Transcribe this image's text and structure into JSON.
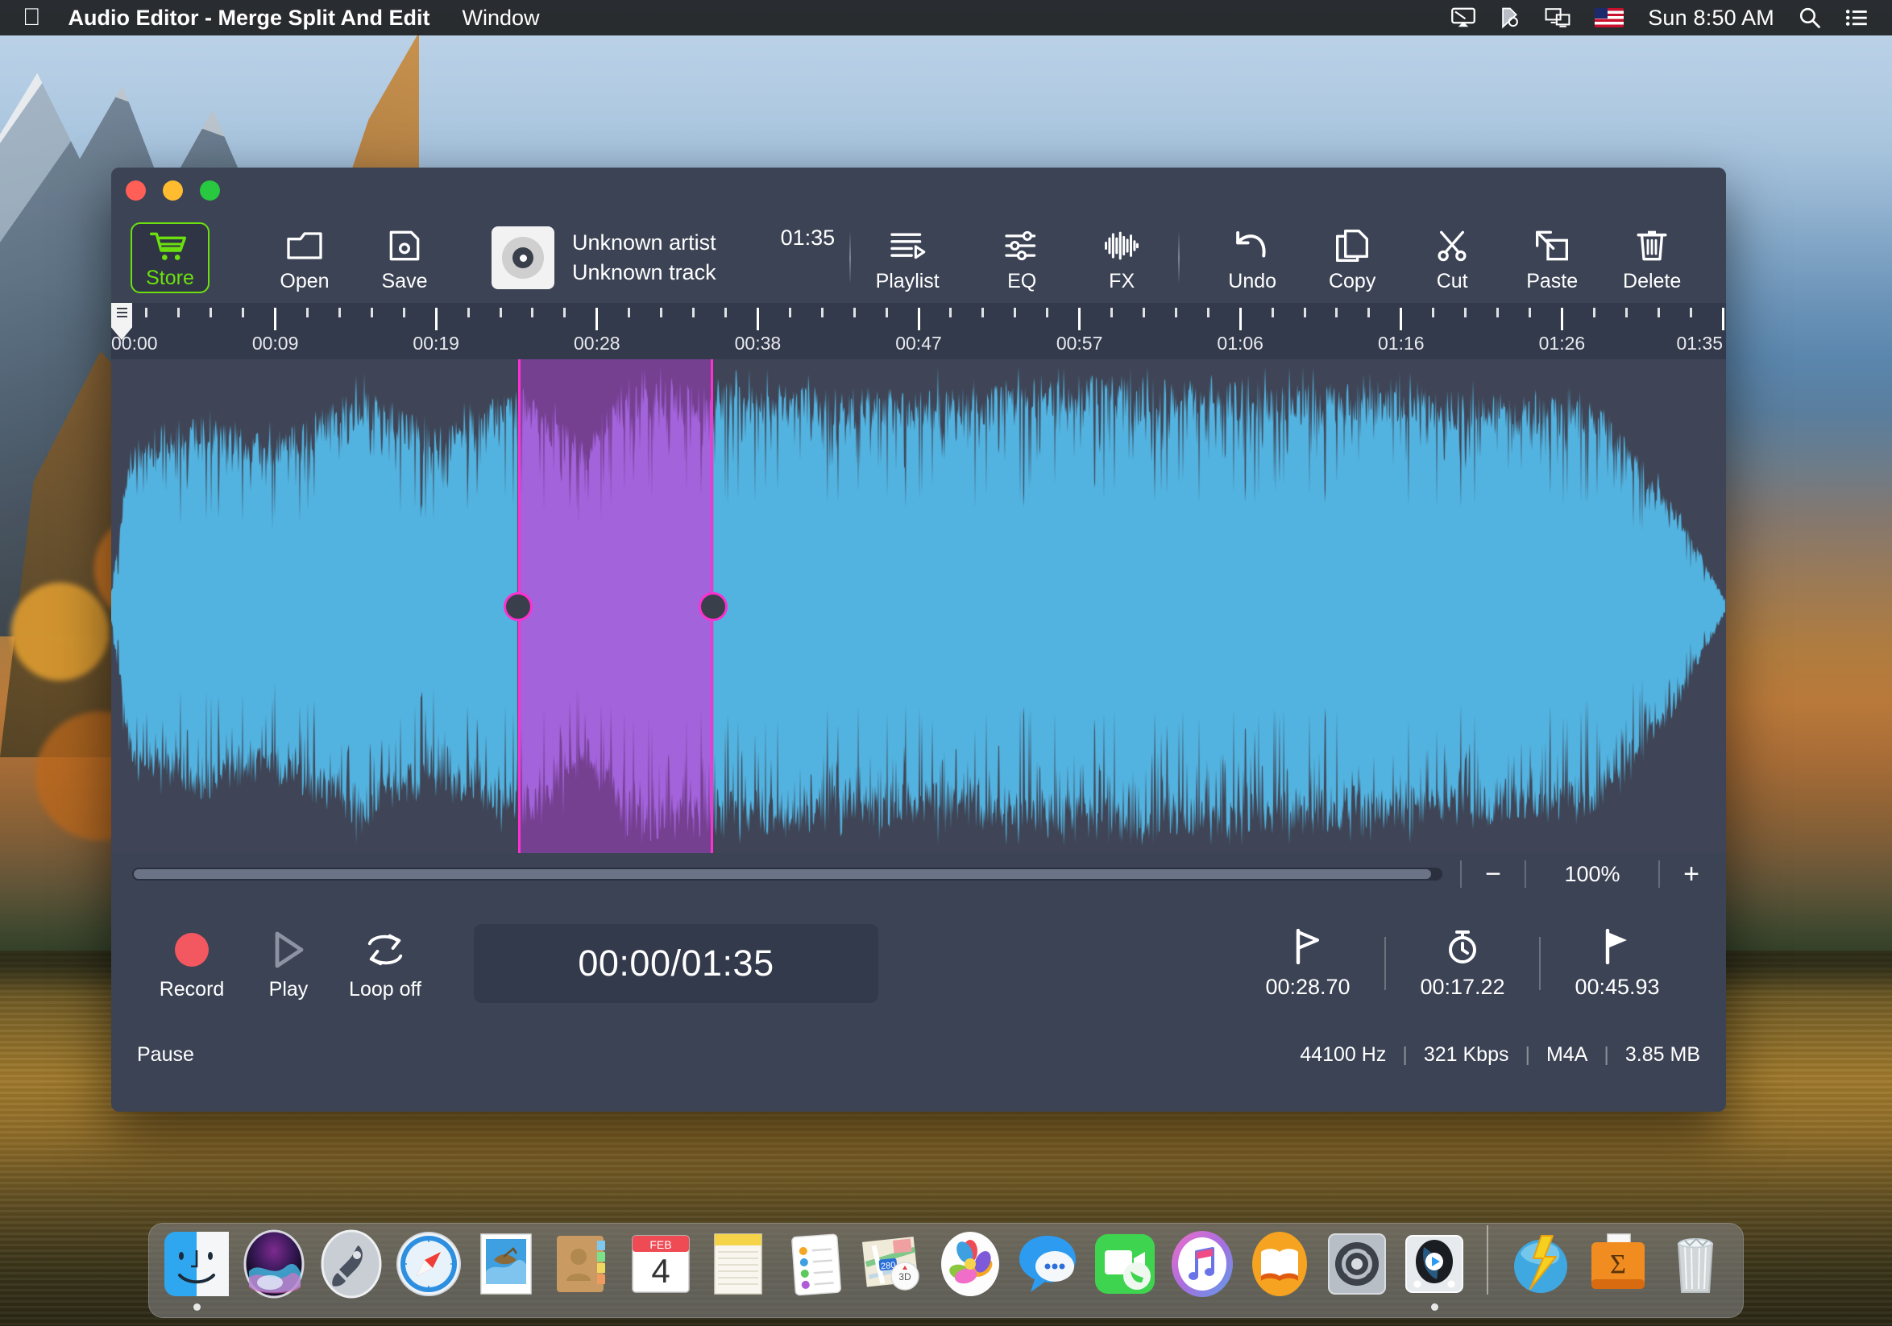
{
  "menubar": {
    "apple_logo": "",
    "app_title": "Audio Editor - Merge Split And Edit",
    "window_menu": "Window",
    "clock": "Sun 8:50 AM",
    "icons": [
      "airplay-icon",
      "bluetooth-cursor-icon",
      "screen-mirroring-icon",
      "us-flag-icon",
      "search-icon",
      "control-center-icon"
    ]
  },
  "window": {
    "toolbar": {
      "store_label": "Store",
      "open_label": "Open",
      "save_label": "Save",
      "playlist_label": "Playlist",
      "eq_label": "EQ",
      "fx_label": "FX",
      "undo_label": "Undo",
      "copy_label": "Copy",
      "cut_label": "Cut",
      "paste_label": "Paste",
      "delete_label": "Delete"
    },
    "track": {
      "artist": "Unknown artist",
      "title": "Unknown track",
      "duration": "01:35"
    },
    "ruler": {
      "labels": [
        "00:00",
        "00:09",
        "00:19",
        "00:28",
        "00:38",
        "00:47",
        "00:57",
        "01:06",
        "01:16",
        "01:26",
        "01:35"
      ]
    },
    "zoom": {
      "minus": "−",
      "value": "100%",
      "plus": "+"
    },
    "transport": {
      "record_label": "Record",
      "play_label": "Play",
      "loop_label": "Loop off",
      "time_display": "00:00/01:35",
      "marker_start": "00:28.70",
      "marker_duration": "00:17.22",
      "marker_end": "00:45.93"
    },
    "status": {
      "state": "Pause",
      "sample_rate": "44100 Hz",
      "bitrate": "321 Kbps",
      "format": "M4A",
      "filesize": "3.85 MB",
      "divider": "|"
    }
  },
  "colors": {
    "window_bg": "#3c4355",
    "wave_bg": "#3f4556",
    "waveform": "#53b3e0",
    "selection": "#a83cc8",
    "selection_edge": "#ff2fd0",
    "store_accent": "#6ce00f",
    "record": "#f3575f"
  },
  "dock": {
    "items": [
      {
        "name": "finder",
        "running": true
      },
      {
        "name": "siri",
        "running": false
      },
      {
        "name": "launchpad",
        "running": false
      },
      {
        "name": "safari",
        "running": false
      },
      {
        "name": "mail",
        "running": false
      },
      {
        "name": "contacts",
        "running": false
      },
      {
        "name": "calendar",
        "running": false,
        "month": "FEB",
        "day": "4"
      },
      {
        "name": "notes",
        "running": false
      },
      {
        "name": "reminders",
        "running": false
      },
      {
        "name": "maps",
        "running": false,
        "badge": "3D",
        "road": "280"
      },
      {
        "name": "photos",
        "running": false
      },
      {
        "name": "messages",
        "running": false
      },
      {
        "name": "facetime",
        "running": false
      },
      {
        "name": "itunes",
        "running": false
      },
      {
        "name": "ibooks",
        "running": false
      },
      {
        "name": "system-preferences",
        "running": false
      },
      {
        "name": "audio-editor",
        "running": true
      },
      {
        "name": "downloads-stack",
        "running": false
      },
      {
        "name": "documents-stack",
        "running": false,
        "glyph": "Σ"
      },
      {
        "name": "trash",
        "running": false
      }
    ]
  }
}
